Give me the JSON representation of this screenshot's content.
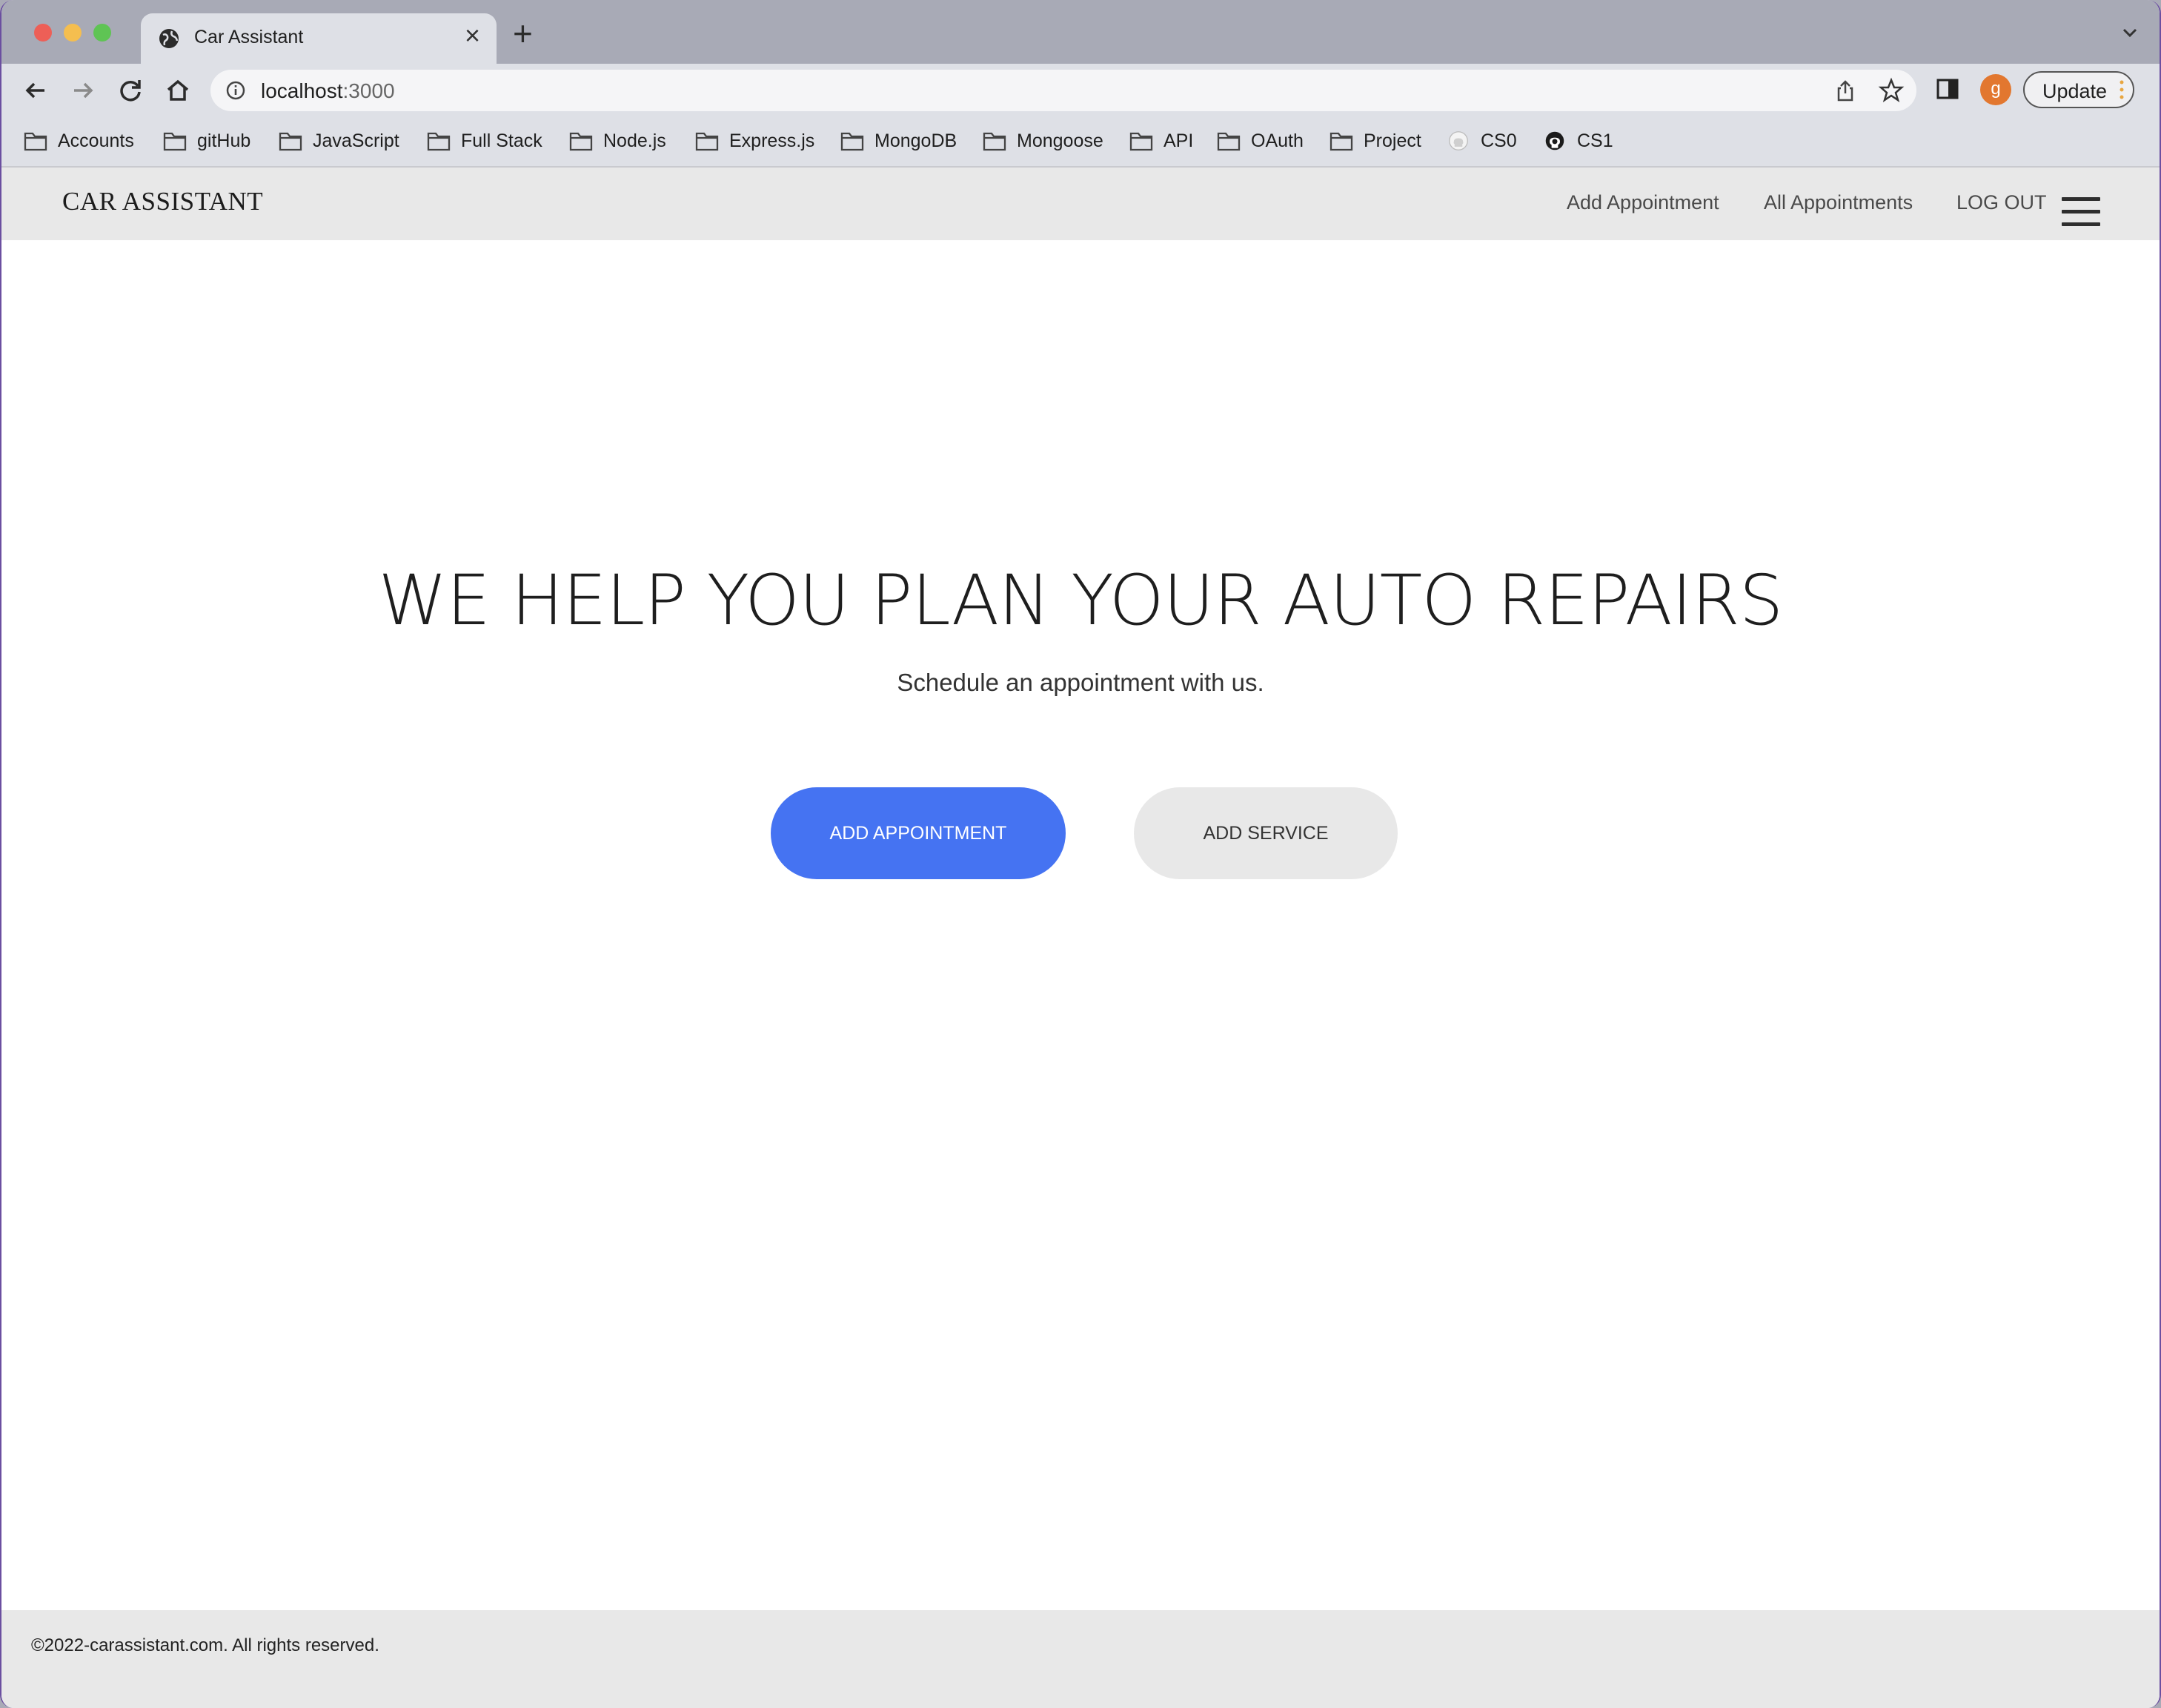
{
  "browser": {
    "tab_title": "Car Assistant",
    "url_host": "localhost",
    "url_port": ":3000",
    "update_label": "Update",
    "avatar_initial": "g",
    "bookmarks": [
      {
        "label": "Accounts",
        "icon": "folder-icon"
      },
      {
        "label": "gitHub",
        "icon": "folder-icon"
      },
      {
        "label": "JavaScript",
        "icon": "folder-icon"
      },
      {
        "label": "Full Stack",
        "icon": "folder-icon"
      },
      {
        "label": "Node.js",
        "icon": "folder-icon"
      },
      {
        "label": "Express.js",
        "icon": "folder-icon"
      },
      {
        "label": "MongoDB",
        "icon": "folder-icon"
      },
      {
        "label": "Mongoose",
        "icon": "folder-icon"
      },
      {
        "label": "API",
        "icon": "folder-icon"
      },
      {
        "label": "OAuth",
        "icon": "folder-icon"
      },
      {
        "label": "Project",
        "icon": "folder-icon"
      },
      {
        "label": "CS0",
        "icon": "github-icon"
      },
      {
        "label": "CS1",
        "icon": "github-icon"
      }
    ]
  },
  "site": {
    "brand": "CAR ASSISTANT",
    "nav": {
      "add_appointment": "Add Appointment",
      "all_appointments": "All Appointments",
      "log_out": "LOG OUT"
    },
    "hero": {
      "title": "WE HELP YOU PLAN YOUR AUTO REPAIRS",
      "subtitle": "Schedule an appointment with us.",
      "primary_button": "ADD APPOINTMENT",
      "secondary_button": "ADD SERVICE"
    },
    "footer": "©2022-carassistant.com. All rights reserved."
  },
  "colors": {
    "accent": "#4573f2",
    "nav_bg": "#e8e8e8",
    "avatar": "#e2772f"
  }
}
